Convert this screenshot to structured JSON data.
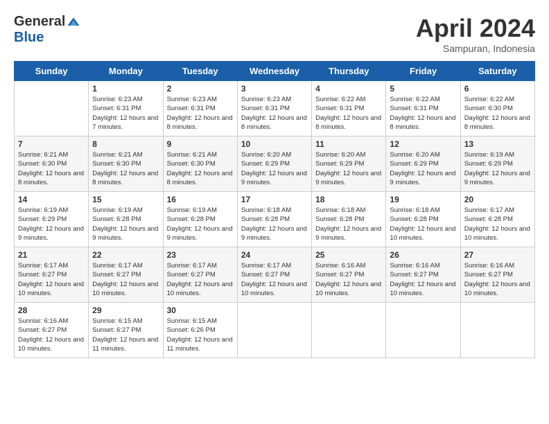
{
  "header": {
    "logo_general": "General",
    "logo_blue": "Blue",
    "month": "April 2024",
    "location": "Sampuran, Indonesia"
  },
  "days_of_week": [
    "Sunday",
    "Monday",
    "Tuesday",
    "Wednesday",
    "Thursday",
    "Friday",
    "Saturday"
  ],
  "weeks": [
    [
      {
        "day": "",
        "sunrise": "",
        "sunset": "",
        "daylight": ""
      },
      {
        "day": "1",
        "sunrise": "Sunrise: 6:23 AM",
        "sunset": "Sunset: 6:31 PM",
        "daylight": "Daylight: 12 hours and 7 minutes."
      },
      {
        "day": "2",
        "sunrise": "Sunrise: 6:23 AM",
        "sunset": "Sunset: 6:31 PM",
        "daylight": "Daylight: 12 hours and 8 minutes."
      },
      {
        "day": "3",
        "sunrise": "Sunrise: 6:23 AM",
        "sunset": "Sunset: 6:31 PM",
        "daylight": "Daylight: 12 hours and 8 minutes."
      },
      {
        "day": "4",
        "sunrise": "Sunrise: 6:22 AM",
        "sunset": "Sunset: 6:31 PM",
        "daylight": "Daylight: 12 hours and 8 minutes."
      },
      {
        "day": "5",
        "sunrise": "Sunrise: 6:22 AM",
        "sunset": "Sunset: 6:31 PM",
        "daylight": "Daylight: 12 hours and 8 minutes."
      },
      {
        "day": "6",
        "sunrise": "Sunrise: 6:22 AM",
        "sunset": "Sunset: 6:30 PM",
        "daylight": "Daylight: 12 hours and 8 minutes."
      }
    ],
    [
      {
        "day": "7",
        "sunrise": "Sunrise: 6:21 AM",
        "sunset": "Sunset: 6:30 PM",
        "daylight": "Daylight: 12 hours and 8 minutes."
      },
      {
        "day": "8",
        "sunrise": "Sunrise: 6:21 AM",
        "sunset": "Sunset: 6:30 PM",
        "daylight": "Daylight: 12 hours and 8 minutes."
      },
      {
        "day": "9",
        "sunrise": "Sunrise: 6:21 AM",
        "sunset": "Sunset: 6:30 PM",
        "daylight": "Daylight: 12 hours and 8 minutes."
      },
      {
        "day": "10",
        "sunrise": "Sunrise: 6:20 AM",
        "sunset": "Sunset: 6:29 PM",
        "daylight": "Daylight: 12 hours and 9 minutes."
      },
      {
        "day": "11",
        "sunrise": "Sunrise: 6:20 AM",
        "sunset": "Sunset: 6:29 PM",
        "daylight": "Daylight: 12 hours and 9 minutes."
      },
      {
        "day": "12",
        "sunrise": "Sunrise: 6:20 AM",
        "sunset": "Sunset: 6:29 PM",
        "daylight": "Daylight: 12 hours and 9 minutes."
      },
      {
        "day": "13",
        "sunrise": "Sunrise: 6:19 AM",
        "sunset": "Sunset: 6:29 PM",
        "daylight": "Daylight: 12 hours and 9 minutes."
      }
    ],
    [
      {
        "day": "14",
        "sunrise": "Sunrise: 6:19 AM",
        "sunset": "Sunset: 6:29 PM",
        "daylight": "Daylight: 12 hours and 9 minutes."
      },
      {
        "day": "15",
        "sunrise": "Sunrise: 6:19 AM",
        "sunset": "Sunset: 6:28 PM",
        "daylight": "Daylight: 12 hours and 9 minutes."
      },
      {
        "day": "16",
        "sunrise": "Sunrise: 6:19 AM",
        "sunset": "Sunset: 6:28 PM",
        "daylight": "Daylight: 12 hours and 9 minutes."
      },
      {
        "day": "17",
        "sunrise": "Sunrise: 6:18 AM",
        "sunset": "Sunset: 6:28 PM",
        "daylight": "Daylight: 12 hours and 9 minutes."
      },
      {
        "day": "18",
        "sunrise": "Sunrise: 6:18 AM",
        "sunset": "Sunset: 6:28 PM",
        "daylight": "Daylight: 12 hours and 9 minutes."
      },
      {
        "day": "19",
        "sunrise": "Sunrise: 6:18 AM",
        "sunset": "Sunset: 6:28 PM",
        "daylight": "Daylight: 12 hours and 10 minutes."
      },
      {
        "day": "20",
        "sunrise": "Sunrise: 6:17 AM",
        "sunset": "Sunset: 6:28 PM",
        "daylight": "Daylight: 12 hours and 10 minutes."
      }
    ],
    [
      {
        "day": "21",
        "sunrise": "Sunrise: 6:17 AM",
        "sunset": "Sunset: 6:27 PM",
        "daylight": "Daylight: 12 hours and 10 minutes."
      },
      {
        "day": "22",
        "sunrise": "Sunrise: 6:17 AM",
        "sunset": "Sunset: 6:27 PM",
        "daylight": "Daylight: 12 hours and 10 minutes."
      },
      {
        "day": "23",
        "sunrise": "Sunrise: 6:17 AM",
        "sunset": "Sunset: 6:27 PM",
        "daylight": "Daylight: 12 hours and 10 minutes."
      },
      {
        "day": "24",
        "sunrise": "Sunrise: 6:17 AM",
        "sunset": "Sunset: 6:27 PM",
        "daylight": "Daylight: 12 hours and 10 minutes."
      },
      {
        "day": "25",
        "sunrise": "Sunrise: 6:16 AM",
        "sunset": "Sunset: 6:27 PM",
        "daylight": "Daylight: 12 hours and 10 minutes."
      },
      {
        "day": "26",
        "sunrise": "Sunrise: 6:16 AM",
        "sunset": "Sunset: 6:27 PM",
        "daylight": "Daylight: 12 hours and 10 minutes."
      },
      {
        "day": "27",
        "sunrise": "Sunrise: 6:16 AM",
        "sunset": "Sunset: 6:27 PM",
        "daylight": "Daylight: 12 hours and 10 minutes."
      }
    ],
    [
      {
        "day": "28",
        "sunrise": "Sunrise: 6:16 AM",
        "sunset": "Sunset: 6:27 PM",
        "daylight": "Daylight: 12 hours and 10 minutes."
      },
      {
        "day": "29",
        "sunrise": "Sunrise: 6:15 AM",
        "sunset": "Sunset: 6:27 PM",
        "daylight": "Daylight: 12 hours and 11 minutes."
      },
      {
        "day": "30",
        "sunrise": "Sunrise: 6:15 AM",
        "sunset": "Sunset: 6:26 PM",
        "daylight": "Daylight: 12 hours and 11 minutes."
      },
      {
        "day": "",
        "sunrise": "",
        "sunset": "",
        "daylight": ""
      },
      {
        "day": "",
        "sunrise": "",
        "sunset": "",
        "daylight": ""
      },
      {
        "day": "",
        "sunrise": "",
        "sunset": "",
        "daylight": ""
      },
      {
        "day": "",
        "sunrise": "",
        "sunset": "",
        "daylight": ""
      }
    ]
  ]
}
